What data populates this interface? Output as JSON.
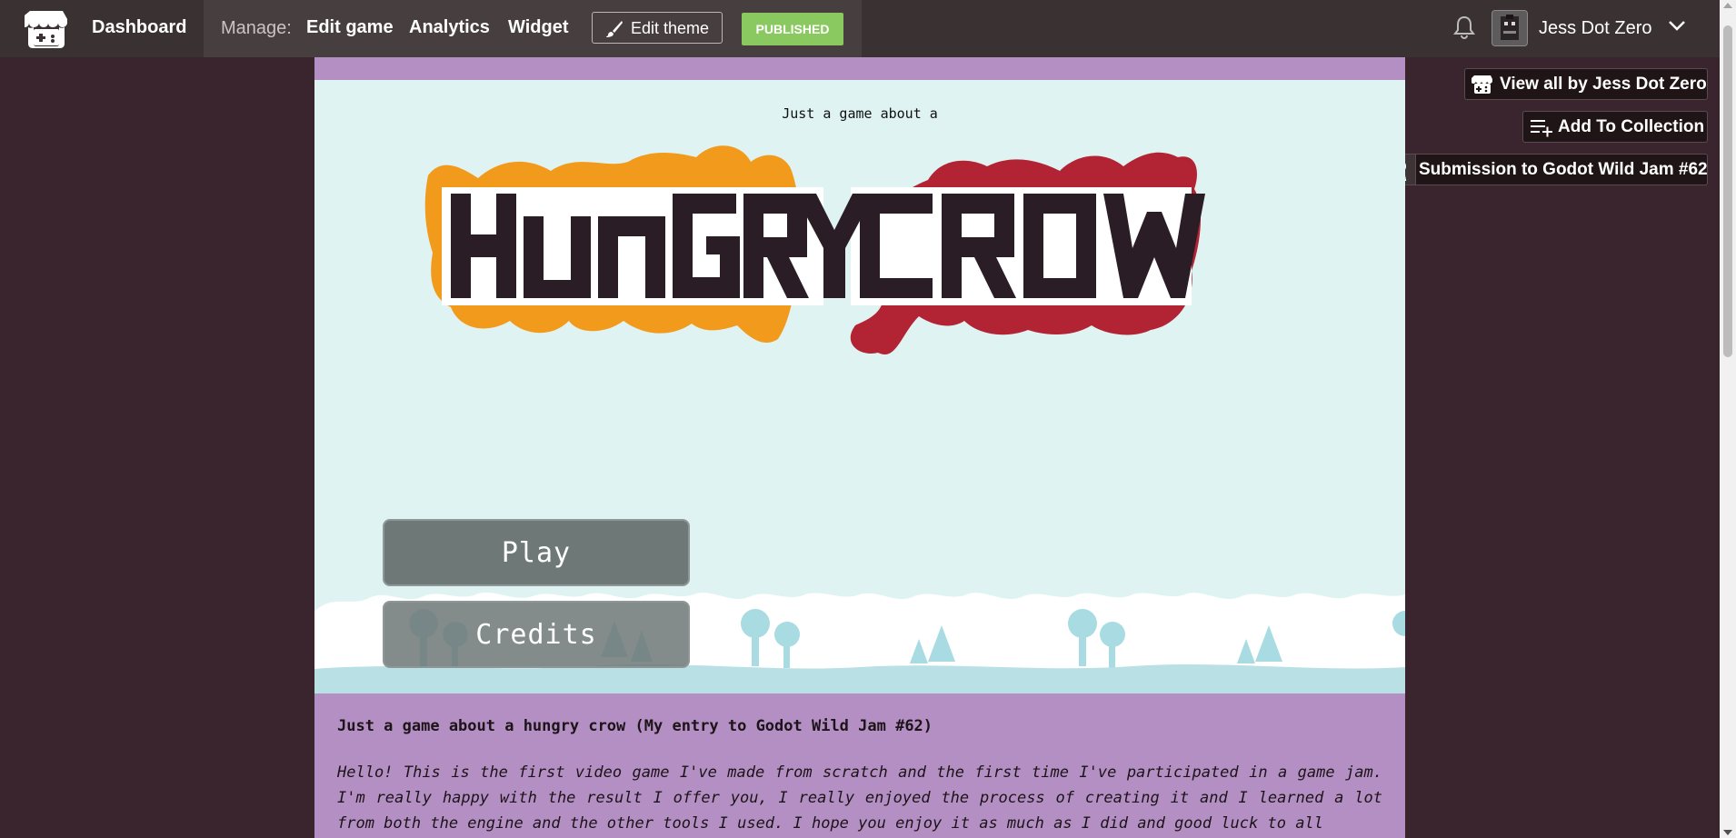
{
  "navbar": {
    "dashboard_label": "Dashboard",
    "manage_label": "Manage:",
    "links": [
      "Edit game",
      "Analytics",
      "Widget"
    ],
    "edit_theme_label": "Edit theme",
    "published_badge": "PUBLISHED",
    "username": "Jess Dot Zero"
  },
  "sidebar_actions": {
    "view_all_label": "View all by Jess Dot Zero",
    "add_collection_label": "Add To Collection",
    "jam_label": "Submission to Godot Wild Jam #62"
  },
  "game": {
    "tagline": "Just a game about a",
    "title_words": [
      "HUNGRY",
      "CROW"
    ],
    "play_label": "Play",
    "credits_label": "Credits",
    "description_title": "Just a game about a hungry crow (My entry to Godot Wild Jam #62)",
    "description_body": "Hello! This is the first video game I've made from scratch and the first time I've participated in a game jam. I'm really happy with the result I offer you, I really enjoyed the process of creating it and I learned a lot from both the engine and the other tools I used. I hope you enjoy it as much as I did and good luck to all"
  },
  "colors": {
    "page_bg": "#3a252e",
    "navbar_bg": "#3a3232",
    "column_bg": "#b48fc3",
    "stage_bg": "#dff4f2",
    "orange": "#f29a1c",
    "red": "#b22334",
    "published": "#8ac860"
  },
  "icons": [
    "itchio-logo-icon",
    "brush-icon",
    "bell-icon",
    "chevron-down-icon",
    "controller-icon",
    "playlist-add-icon",
    "ribbon-icon"
  ]
}
